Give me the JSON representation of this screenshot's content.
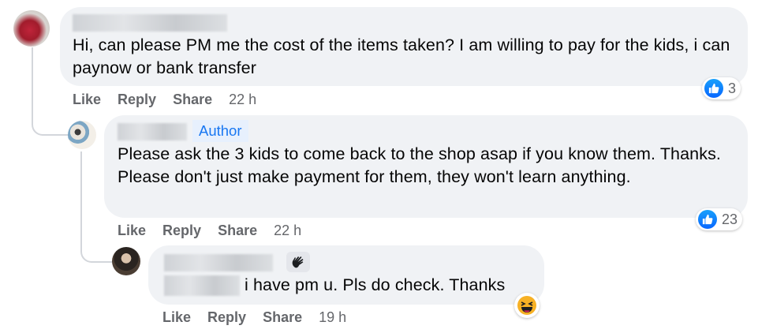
{
  "comments": [
    {
      "text": "Hi, can please PM me the cost of the items taken? I am willing to pay for the kids, i can paynow or bank transfer",
      "actions": {
        "like": "Like",
        "reply": "Reply",
        "share": "Share",
        "time": "22 h"
      },
      "reaction_count": "3",
      "reaction_icon": "like-icon"
    },
    {
      "author_badge": "Author",
      "text": "Please ask the 3 kids to come back to the shop asap if you know them. Thanks. Please don't just make payment for them, they won't learn anything.",
      "actions": {
        "like": "Like",
        "reply": "Reply",
        "share": "Share",
        "time": "22 h"
      },
      "reaction_count": "23",
      "reaction_icon": "like-icon"
    },
    {
      "text": "i have pm u. Pls do check. Thanks",
      "actions": {
        "like": "Like",
        "reply": "Reply",
        "share": "Share",
        "time": "19 h"
      },
      "reaction_icon": "haha-icon",
      "badge_icon": "waving-hand-icon"
    }
  ],
  "colors": {
    "bubble": "#f0f2f5",
    "link": "#1877f2",
    "meta": "#65676b",
    "like": "#0866ff",
    "haha": "#f7b125"
  }
}
